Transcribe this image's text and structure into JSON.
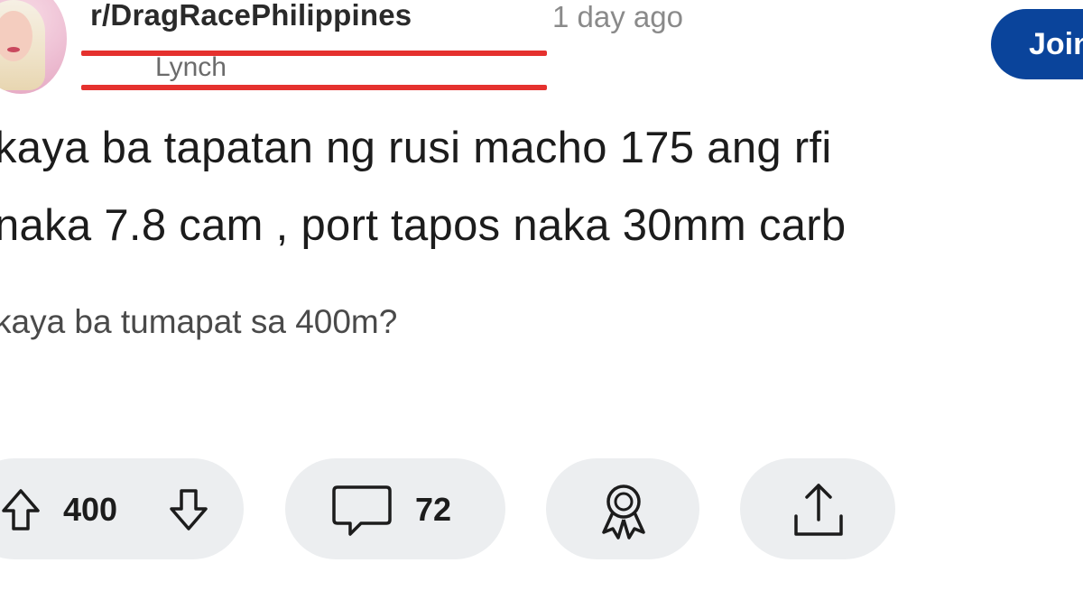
{
  "post": {
    "subreddit": "r/DragRacePhilippines",
    "time": "1 day ago",
    "username": "Lynch",
    "join_label": "Join",
    "title_lines": [
      "kaya ba tapatan ng rusi macho 175 ang rfi",
      "naka 7.8 cam , port tapos naka 30mm carb"
    ],
    "body": "kaya ba tumapat sa 400m?"
  },
  "actions": {
    "vote_count": "400",
    "comment_count": "72"
  },
  "icons": {
    "upvote": "upvote-arrow-icon",
    "downvote": "downvote-arrow-icon",
    "comment": "speech-bubble-icon",
    "award": "award-ribbon-icon",
    "share": "share-upload-icon"
  },
  "colors": {
    "join_button": "#0a449b",
    "redaction_line": "#e5312e",
    "pill_background": "#eceef0",
    "meta_text": "#8a8a8a"
  }
}
